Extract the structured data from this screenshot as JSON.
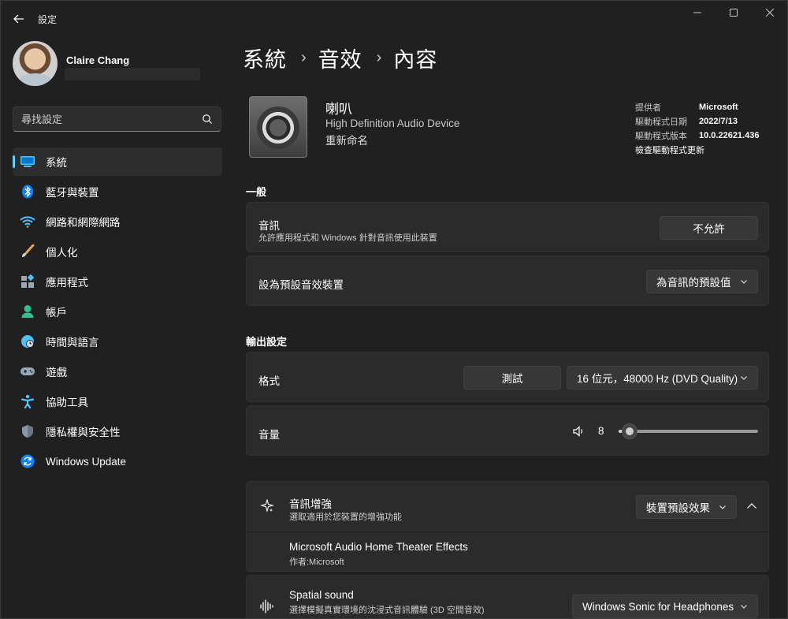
{
  "window": {
    "title": "設定"
  },
  "profile": {
    "name": "Claire Chang"
  },
  "search": {
    "placeholder": "尋找設定"
  },
  "sidebar": {
    "items": [
      {
        "label": "系統",
        "icon": "system-display-icon",
        "active": true
      },
      {
        "label": "藍牙與裝置",
        "icon": "bluetooth-icon"
      },
      {
        "label": "網路和網際網路",
        "icon": "wifi-icon"
      },
      {
        "label": "個人化",
        "icon": "paintbrush-icon"
      },
      {
        "label": "應用程式",
        "icon": "apps-icon"
      },
      {
        "label": "帳戶",
        "icon": "account-icon"
      },
      {
        "label": "時間與語言",
        "icon": "globe-clock-icon"
      },
      {
        "label": "遊戲",
        "icon": "gamepad-icon"
      },
      {
        "label": "協助工具",
        "icon": "accessibility-icon"
      },
      {
        "label": "隱私權與安全性",
        "icon": "shield-icon"
      },
      {
        "label": "Windows Update",
        "icon": "update-icon"
      }
    ]
  },
  "breadcrumb": {
    "items": [
      "系統",
      "音效",
      "內容"
    ],
    "separator": "›"
  },
  "device": {
    "name": "喇叭",
    "description": "High Definition Audio Device",
    "rename_label": "重新命名"
  },
  "driver": {
    "provider_label": "提供者",
    "provider_value": "Microsoft",
    "date_label": "驅動程式日期",
    "date_value": "2022/7/13",
    "version_label": "驅動程式版本",
    "version_value": "10.0.22621.436",
    "update_link": "檢查驅動程式更新"
  },
  "general": {
    "section_title": "一般",
    "audio_title": "音訊",
    "audio_sub": "允許應用程式和 Windows 針對音訊使用此裝置",
    "audio_button": "不允許",
    "default_title": "設為預設音效裝置",
    "default_dropdown": "為音訊的預設值"
  },
  "output": {
    "section_title": "輸出設定",
    "format_title": "格式",
    "test_button": "測試",
    "format_dropdown": "16 位元，48000 Hz (DVD Quality)",
    "volume_title": "音量",
    "volume_value": "8",
    "volume_level": 0.08
  },
  "enhance": {
    "title": "音訊增強",
    "sub": "選取適用於您裝置的增強功能",
    "dropdown": "裝置預設效果",
    "effect_name": "Microsoft Audio Home Theater Effects",
    "effect_author": "作者:Microsoft"
  },
  "spatial": {
    "title": "Spatial sound",
    "sub": "選擇模擬真實環境的沈浸式音訊體驗 (3D 空間音效)",
    "dropdown": "Windows Sonic for Headphones"
  },
  "colors": {
    "accent": "#60cdff",
    "background": "#202020",
    "card": "#2b2b2b"
  }
}
